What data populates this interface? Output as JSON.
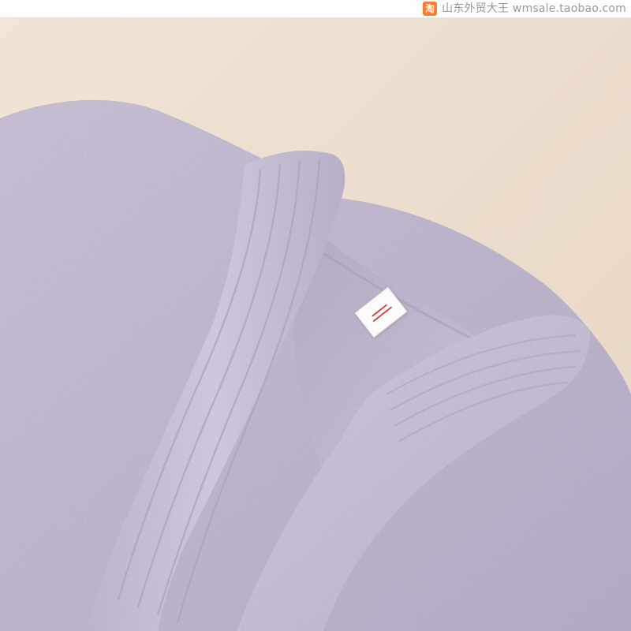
{
  "photo": {
    "subject": "",
    "colors": {
      "background": "#efe2d3",
      "fabric": "#c5bdd1",
      "fabric_shadow": "#a89fb6",
      "fabric_highlight": "#d9d2e3",
      "label": "#fbfbfb",
      "label_print": "#cf4b4b"
    }
  },
  "watermark": {
    "icon": "taobao-icon",
    "icon_glyph": "淘",
    "icon_color": "#ff7a2a",
    "text": "山东外贸大王 wmsale.taobao.com",
    "text_color": "#9a9a9a"
  }
}
